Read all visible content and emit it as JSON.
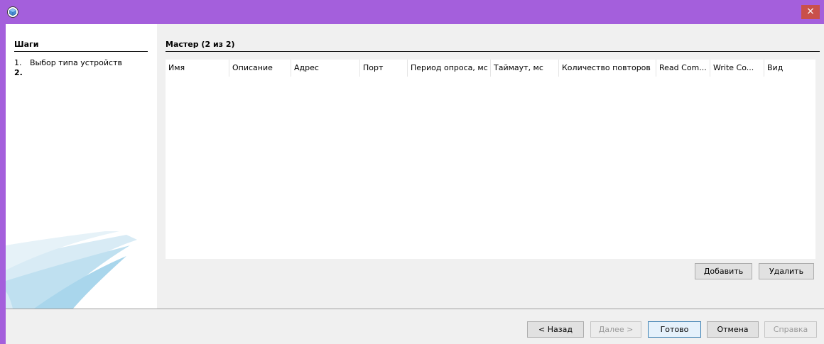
{
  "window": {
    "close_glyph": "×",
    "icon": "app-cube-icon"
  },
  "steps": {
    "title": "Шаги",
    "items": [
      {
        "num": "1.",
        "label": "Выбор типа устройств"
      },
      {
        "num": "2.",
        "label": ""
      }
    ]
  },
  "main": {
    "title": "Мастер (2 из 2)",
    "columns": [
      "Имя",
      "Описание",
      "Адрес",
      "Порт",
      "Период опроса, мс",
      "Таймаут, мс",
      "Количество повторов",
      "Read Com...",
      "Write Co...",
      "Вид"
    ],
    "rows": []
  },
  "table_buttons": {
    "add": "Добавить",
    "remove": "Удалить"
  },
  "footer": {
    "back": "< Назад",
    "next": "Далее >",
    "finish": "Готово",
    "cancel": "Отмена",
    "help": "Справка"
  },
  "colors": {
    "titlebar": "#a45fdc",
    "close": "#c9504a",
    "client": "#f0f0f0"
  }
}
